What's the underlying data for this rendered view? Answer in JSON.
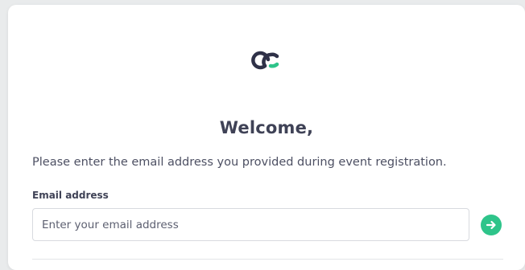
{
  "brand": {
    "logo_icon": "cc-brand-logo-icon",
    "logo_dark_color": "#2f3148",
    "logo_accent_color": "#2ec48a"
  },
  "welcome": {
    "title": "Welcome,",
    "description": "Please enter the email address you provided during event registration."
  },
  "form": {
    "email_label": "Email address",
    "email_value": "",
    "email_placeholder": "Enter your email address",
    "submit_icon": "arrow-right-icon",
    "submit_color": "#2ec48a"
  }
}
